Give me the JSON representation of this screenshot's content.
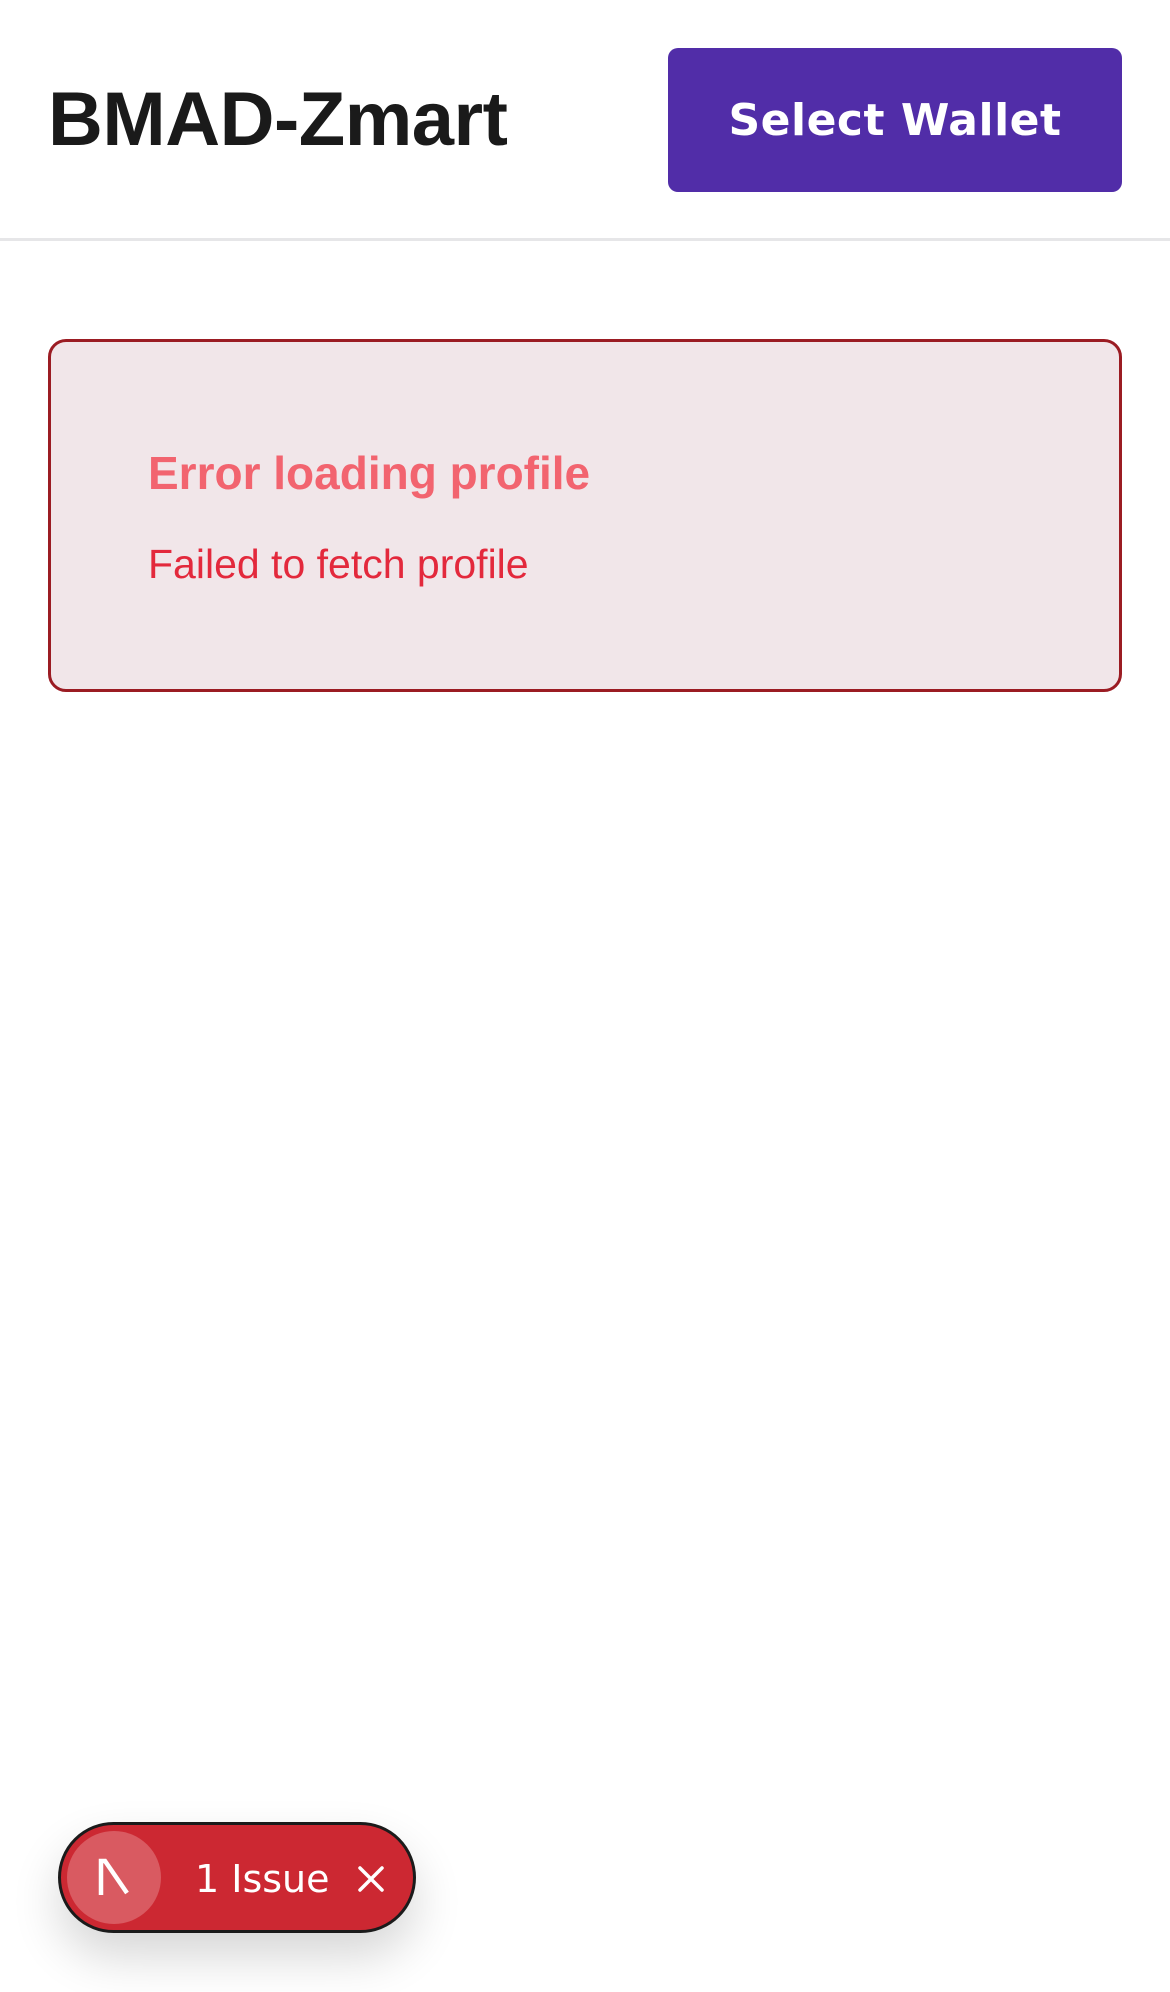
{
  "header": {
    "title": "BMAD-Zmart",
    "wallet_button_label": "Select Wallet"
  },
  "error": {
    "title": "Error loading profile",
    "message": "Failed to fetch profile"
  },
  "dev_overlay": {
    "badge_icon": "nextjs-logo-icon",
    "issue_count_label": "1 Issue",
    "dismiss_icon": "close-icon"
  },
  "colors": {
    "brand_button": "#512da8",
    "error_border": "#9b1c23",
    "error_background": "#f1e6e9",
    "error_title": "#f2646f",
    "error_message": "#e3293c",
    "issues_pill": "#cc2832"
  }
}
